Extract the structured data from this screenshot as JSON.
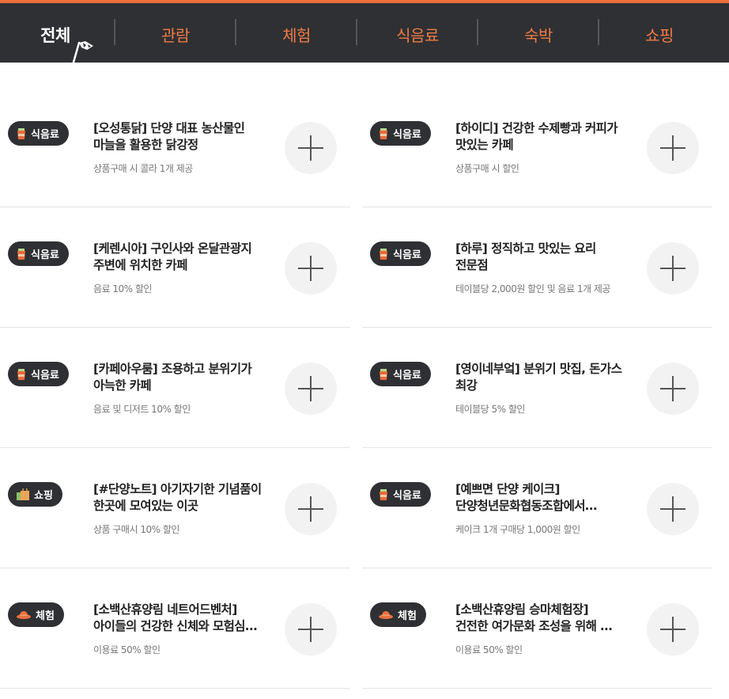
{
  "tabs": [
    {
      "label": "전체",
      "active": true
    },
    {
      "label": "관람",
      "active": false
    },
    {
      "label": "체험",
      "active": false
    },
    {
      "label": "식음료",
      "active": false
    },
    {
      "label": "숙박",
      "active": false
    },
    {
      "label": "쇼핑",
      "active": false
    }
  ],
  "colors": {
    "accent": "#ee6e3c",
    "nav_bg": "#2f3033",
    "badge_bg": "#2f3033"
  },
  "cards": [
    {
      "category": "식음료",
      "icon": "drink-cup-icon",
      "title_line1": "[오성통닭] 단양 대표 농산물인",
      "title_line2": "마늘을 활용한 닭강정",
      "benefit": "상품구매 시 콜라 1개 제공"
    },
    {
      "category": "식음료",
      "icon": "drink-cup-icon",
      "title_line1": "[하이디] 건강한 수제빵과 커피가",
      "title_line2": "맛있는 카페",
      "benefit": "상품구매 시 할인"
    },
    {
      "category": "식음료",
      "icon": "drink-cup-icon",
      "title_line1": "[케렌시아] 구인사와 온달관광지",
      "title_line2": "주변에 위치한 카페",
      "benefit": "음료 10% 할인"
    },
    {
      "category": "식음료",
      "icon": "drink-cup-icon",
      "title_line1": "[하루] 정직하고 맛있는 요리",
      "title_line2": "전문점",
      "benefit": "테이블당 2,000원 할인 및 음료 1개 제공"
    },
    {
      "category": "식음료",
      "icon": "drink-cup-icon",
      "title_line1": "[카페아우룸] 조용하고 분위기가",
      "title_line2": "아늑한 카페",
      "benefit": "음료 및 디저트 10% 할인"
    },
    {
      "category": "식음료",
      "icon": "drink-cup-icon",
      "title_line1": "[영이네부엌] 분위기 맛집, 돈가스",
      "title_line2": "최강",
      "benefit": "테이블당 5% 할인"
    },
    {
      "category": "쇼핑",
      "icon": "shopping-bag-icon",
      "title_line1": "[#단양노트] 아기자기한 기념품이",
      "title_line2": "한곳에 모여있는 이곳",
      "benefit": "상품 구매시 10% 할인"
    },
    {
      "category": "식음료",
      "icon": "drink-cup-icon",
      "title_line1": "[예쁘면 단양 케이크]",
      "title_line2": "단양청년문화협동조합에서…",
      "benefit": "케이크 1개 구매당 1,000원 할인"
    },
    {
      "category": "체험",
      "icon": "hat-icon",
      "title_line1": "[소백산휴양림 네트어드벤처]",
      "title_line2": "아이들의 건강한 신체와 모험심…",
      "benefit": "이용료 50% 할인"
    },
    {
      "category": "체험",
      "icon": "hat-icon",
      "title_line1": "[소백산휴양림 승마체험장]",
      "title_line2": "건전한 여가문화 조성을 위해 …",
      "benefit": "이용료 50% 할인"
    }
  ]
}
